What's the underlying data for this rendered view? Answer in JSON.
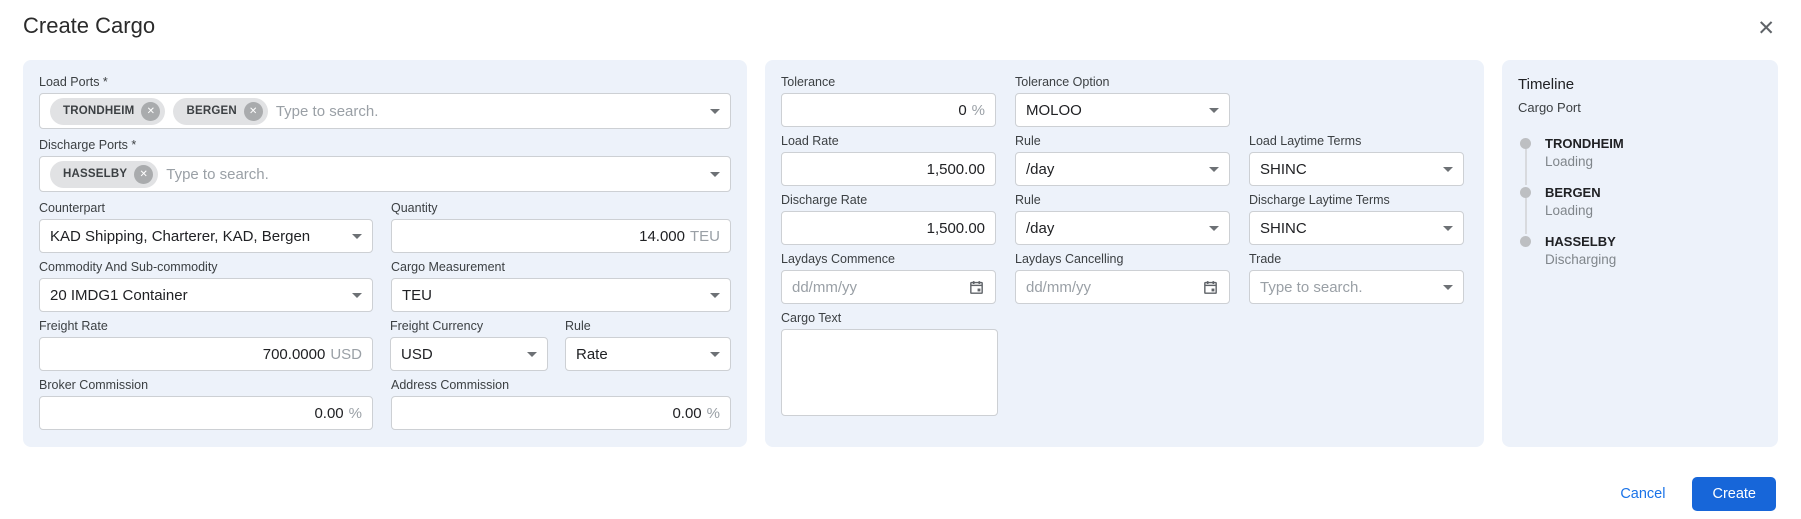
{
  "modal": {
    "title": "Create Cargo"
  },
  "colors": {
    "panel_bg": "#edf2fa",
    "accent_blue": "#1766d9",
    "link_blue": "#1a73e8",
    "chip_bg": "#e1e2e4"
  },
  "left_panel": {
    "load_ports": {
      "label": "Load Ports *",
      "chips": [
        "TRONDHEIM",
        "BERGEN"
      ],
      "placeholder": "Type to search."
    },
    "discharge_ports": {
      "label": "Discharge Ports *",
      "chips": [
        "HASSELBY"
      ],
      "placeholder": "Type to search."
    },
    "counterpart": {
      "label": "Counterpart",
      "value": "KAD Shipping, Charterer, KAD, Bergen"
    },
    "quantity": {
      "label": "Quantity",
      "value": "14.000",
      "suffix": "TEU"
    },
    "commodity": {
      "label": "Commodity And Sub-commodity",
      "value": "20 IMDG1 Container"
    },
    "cargo_measurement": {
      "label": "Cargo Measurement",
      "value": "TEU"
    },
    "freight_rate": {
      "label": "Freight Rate",
      "value": "700.0000",
      "suffix": "USD"
    },
    "freight_currency": {
      "label": "Freight Currency",
      "value": "USD"
    },
    "freight_rule": {
      "label": "Rule",
      "value": "Rate"
    },
    "broker_commission": {
      "label": "Broker Commission",
      "value": "0.00",
      "suffix": "%"
    },
    "address_commission": {
      "label": "Address Commission",
      "value": "0.00",
      "suffix": "%"
    }
  },
  "middle_panel": {
    "tolerance": {
      "label": "Tolerance",
      "value": "0",
      "suffix": "%"
    },
    "tolerance_option": {
      "label": "Tolerance Option",
      "value": "MOLOO"
    },
    "load_rate": {
      "label": "Load Rate",
      "value": "1,500.00"
    },
    "load_rule": {
      "label": "Rule",
      "value": "/day"
    },
    "load_laytime_terms": {
      "label": "Load Laytime Terms",
      "value": "SHINC"
    },
    "discharge_rate": {
      "label": "Discharge Rate",
      "value": "1,500.00"
    },
    "discharge_rule": {
      "label": "Rule",
      "value": "/day"
    },
    "discharge_laytime_terms": {
      "label": "Discharge Laytime Terms",
      "value": "SHINC"
    },
    "laydays_commence": {
      "label": "Laydays Commence",
      "placeholder": "dd/mm/yy"
    },
    "laydays_cancelling": {
      "label": "Laydays Cancelling",
      "placeholder": "dd/mm/yy"
    },
    "trade": {
      "label": "Trade",
      "placeholder": "Type to search."
    },
    "cargo_text": {
      "label": "Cargo Text",
      "value": ""
    }
  },
  "timeline": {
    "title": "Timeline",
    "subtitle": "Cargo Port",
    "items": [
      {
        "port": "TRONDHEIM",
        "activity": "Loading"
      },
      {
        "port": "BERGEN",
        "activity": "Loading"
      },
      {
        "port": "HASSELBY",
        "activity": "Discharging"
      }
    ]
  },
  "footer": {
    "cancel_label": "Cancel",
    "create_label": "Create"
  },
  "icons": {
    "close": "✕",
    "chip_remove": "✕"
  }
}
